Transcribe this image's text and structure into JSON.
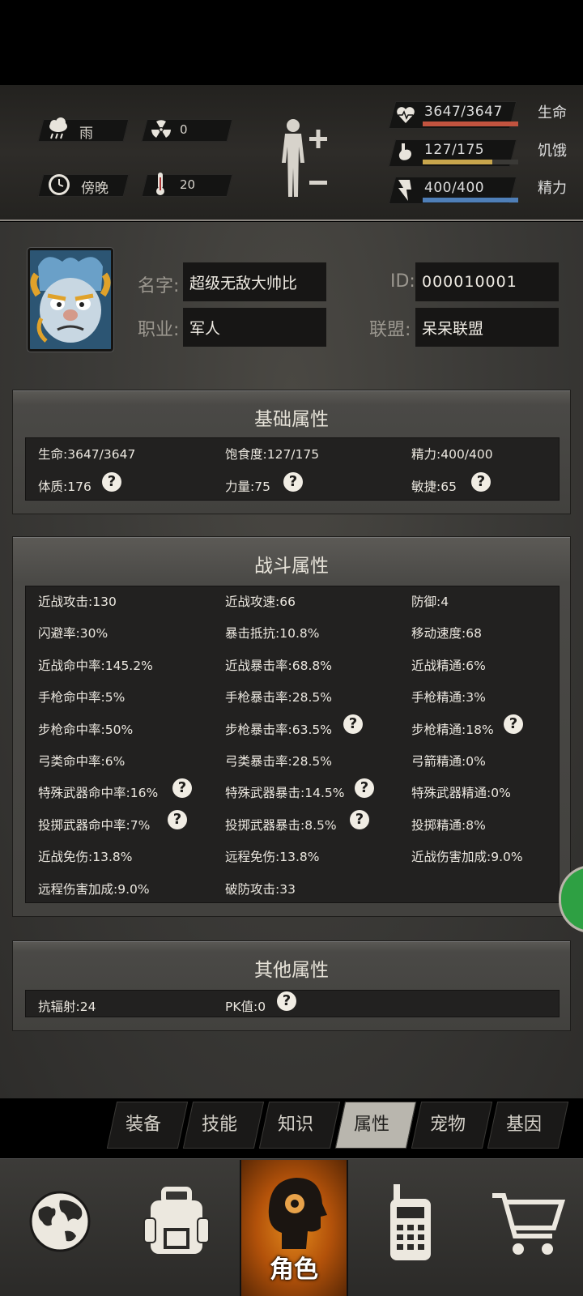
{
  "status": {
    "weather": {
      "icon": "rain-cloud-icon",
      "label": "雨"
    },
    "radiation": {
      "icon": "radiation-icon",
      "value": "0"
    },
    "time": {
      "icon": "clock-icon",
      "label": "傍晚"
    },
    "temperature": {
      "icon": "thermometer-icon",
      "value": "20"
    },
    "bars": [
      {
        "icon": "heart-icon",
        "value": "3647/3647",
        "label": "生命",
        "fill": 1.0,
        "color": "#c2533f"
      },
      {
        "icon": "stomach-icon",
        "value": "127/175",
        "label": "饥饿",
        "fill": 0.726,
        "color": "#c8a64d"
      },
      {
        "icon": "energy-icon",
        "value": "400/400",
        "label": "精力",
        "fill": 1.0,
        "color": "#4f7fb8"
      }
    ]
  },
  "profile": {
    "name_label": "名字:",
    "name": "超级无敌大帅比",
    "id_label": "ID:",
    "id": "000010001",
    "job_label": "职业:",
    "job": "军人",
    "alliance_label": "联盟:",
    "alliance": "呆呆联盟"
  },
  "basic": {
    "title": "基础属性",
    "stats": [
      "生命:3647/3647",
      "饱食度:127/175",
      "精力:400/400",
      "体质:176",
      "力量:75",
      "敏捷:65"
    ]
  },
  "combat": {
    "title": "战斗属性",
    "stats": [
      "近战攻击:130",
      "近战攻速:66",
      "防御:4",
      "闪避率:30%",
      "暴击抵抗:10.8%",
      "移动速度:68",
      "近战命中率:145.2%",
      "近战暴击率:68.8%",
      "近战精通:6%",
      "手枪命中率:5%",
      "手枪暴击率:28.5%",
      "手枪精通:3%",
      "步枪命中率:50%",
      "步枪暴击率:63.5%",
      "步枪精通:18%",
      "弓类命中率:6%",
      "弓类暴击率:28.5%",
      "弓箭精通:0%",
      "特殊武器命中率:16%",
      "特殊武器暴击:14.5%",
      "特殊武器精通:0%",
      "投掷武器命中率:7%",
      "投掷武器暴击:8.5%",
      "投掷精通:8%",
      "近战免伤:13.8%",
      "远程免伤:13.8%",
      "近战伤害加成:9.0%",
      "远程伤害加成:9.0%",
      "破防攻击:33"
    ]
  },
  "other": {
    "title": "其他属性",
    "stats": [
      "抗辐射:24",
      "PK值:0"
    ]
  },
  "help_glyph": "?",
  "tabs": [
    {
      "label": "装备",
      "active": false
    },
    {
      "label": "技能",
      "active": false
    },
    {
      "label": "知识",
      "active": false
    },
    {
      "label": "属性",
      "active": true
    },
    {
      "label": "宠物",
      "active": false
    },
    {
      "label": "基因",
      "active": false
    }
  ],
  "nav": [
    {
      "icon": "globe-icon"
    },
    {
      "icon": "backpack-icon"
    },
    {
      "icon": "character-head-icon",
      "label": "角色",
      "active": true
    },
    {
      "icon": "walkie-talkie-icon"
    },
    {
      "icon": "shopping-cart-icon"
    }
  ]
}
